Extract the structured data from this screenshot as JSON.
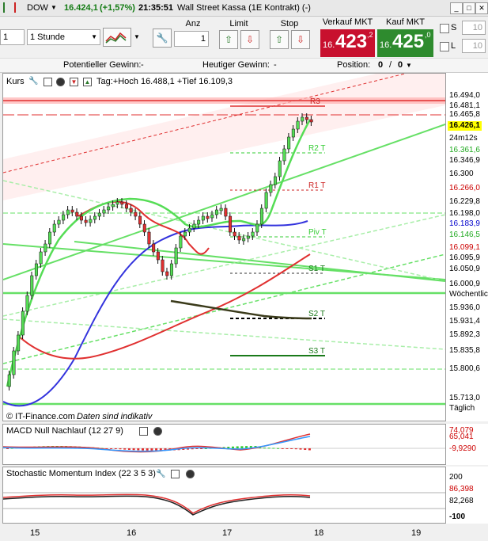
{
  "window": {
    "symbol": "DOW",
    "price": "16.424,1",
    "change": "(+1,57%)",
    "time": "21:35:51",
    "instrument": "Wall Street Kassa (1E Kontrakt) (-)"
  },
  "toolbar": {
    "period_value": "1",
    "interval_value": "1 Stunde",
    "anz_label": "Anz",
    "anz_value": "1",
    "limit_label": "Limit",
    "stop_label": "Stop",
    "sell_label": "Verkauf MKT",
    "sell_prefix": "16.",
    "sell_big": "423",
    "sell_sup": ",2",
    "buy_label": "Kauf MKT",
    "buy_prefix": "16.",
    "buy_big": "425",
    "buy_sup": ",0",
    "s_label": "S",
    "s_value": "10",
    "l_label": "L",
    "l_value": "10"
  },
  "info": {
    "potential": "Potentieller Gewinn:",
    "potential_val": "-",
    "today": "Heutiger Gewinn:",
    "today_val": "-",
    "position": "Position:",
    "position_val": "0",
    "position_sep": "/",
    "position_val2": "0"
  },
  "main": {
    "title": "Kurs",
    "tag": "Tag:+Hoch 16.488,1 +Tief 16.109,3",
    "source": "© IT-Finance.com",
    "indicative": "Daten sind indikativ",
    "levels": {
      "r3": "R3",
      "r2": "R2 T",
      "r1": "R1 T",
      "pv": "Piv T",
      "s1": "S1 T",
      "s2": "S2 T",
      "s3": "S3 T"
    },
    "price_labels": [
      {
        "text": "16.494,0",
        "bg": "#ffffff",
        "color": "#000000"
      },
      {
        "text": "16.481,1",
        "bg": "#ffffff",
        "color": "#000000"
      },
      {
        "text": "16.465,8",
        "bg": "#ffffff",
        "color": "#000000"
      },
      {
        "text": "16.426,1",
        "bg": "#ffff00",
        "color": "#000000"
      },
      {
        "text": "24m12s",
        "bg": "#ffffff",
        "color": "#000000"
      },
      {
        "text": "16.361,6",
        "bg": "#ffffff",
        "color": "#22aa22"
      },
      {
        "text": "16.346,9",
        "bg": "#ffffff",
        "color": "#000000"
      },
      {
        "text": "16.300",
        "bg": "#ffffff",
        "color": "#000000"
      },
      {
        "text": "16.266,0",
        "bg": "#ffffff",
        "color": "#cc0000"
      },
      {
        "text": "16.229,8",
        "bg": "#ffffff",
        "color": "#000000"
      },
      {
        "text": "16.198,0",
        "bg": "#ffffff",
        "color": "#000000"
      },
      {
        "text": "16.183,9",
        "bg": "#ffffff",
        "color": "#0000cc"
      },
      {
        "text": "16.146,5",
        "bg": "#ffffff",
        "color": "#22aa22"
      },
      {
        "text": "16.099,1",
        "bg": "#ffffff",
        "color": "#cc0000"
      },
      {
        "text": "16.095,9",
        "bg": "#ffffff",
        "color": "#000000"
      },
      {
        "text": "16.050,9",
        "bg": "#ffffff",
        "color": "#000000"
      },
      {
        "text": "16.000,9",
        "bg": "#ffffff",
        "color": "#000000"
      },
      {
        "text": "Wöchentlich",
        "bg": "#ffffff",
        "color": "#000000"
      },
      {
        "text": "15.936,0",
        "bg": "#ffffff",
        "color": "#000000"
      },
      {
        "text": "15.931,4",
        "bg": "#ffffff",
        "color": "#000000"
      },
      {
        "text": "15.892,3",
        "bg": "#ffffff",
        "color": "#000000"
      },
      {
        "text": "15.835,8",
        "bg": "#ffffff",
        "color": "#000000"
      },
      {
        "text": "15.800,6",
        "bg": "#ffffff",
        "color": "#000000"
      },
      {
        "text": "15.713,0",
        "bg": "#ffffff",
        "color": "#000000"
      },
      {
        "text": "Täglich",
        "bg": "#ffffff",
        "color": "#000000"
      }
    ]
  },
  "macd": {
    "title": "MACD Null Nachlauf (12 27 9)",
    "labels": [
      {
        "text": "74,079",
        "color": "#cc0000"
      },
      {
        "text": "65,041",
        "color": "#cc0000"
      },
      {
        "text": "-9,9290",
        "color": "#cc0000"
      }
    ]
  },
  "stoch": {
    "title": "Stochastic Momentum Index (22 3 5 3)",
    "labels": [
      {
        "text": "200",
        "color": "#000000"
      },
      {
        "text": "86,398",
        "color": "#cc0000"
      },
      {
        "text": "82,268",
        "color": "#000000"
      },
      {
        "text": "-100",
        "color": "#000000"
      }
    ]
  },
  "xaxis": [
    "15",
    "16",
    "17",
    "18",
    "19"
  ],
  "colors": {
    "sell": "#c8102e",
    "buy": "#2e8b2e",
    "accent": "#2e7d32"
  }
}
